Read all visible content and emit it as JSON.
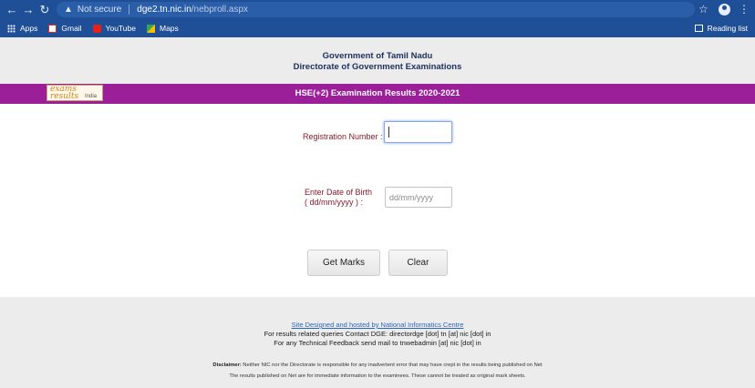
{
  "browser": {
    "not_secure": "Not secure",
    "url_host": "dge2.tn.nic.in",
    "url_path": "/nebproll.aspx",
    "bookmarks": [
      {
        "label": "Apps"
      },
      {
        "label": "Gmail"
      },
      {
        "label": "YouTube"
      },
      {
        "label": "Maps"
      }
    ],
    "reading_list": "Reading list"
  },
  "header": {
    "line1": "Government of Tamil Nadu",
    "line2": "Directorate of Government Examinations"
  },
  "banner": {
    "title": "HSE(+2)  Examination Results 2020-2021",
    "logo_top": "exams",
    "logo_bottom": "results",
    "logo_region": "India"
  },
  "form": {
    "registration_label": "Registration Number :",
    "registration_value": "",
    "dob_label_line1": "Enter Date of Birth",
    "dob_label_line2": "( dd/mm/yyyy ) :",
    "dob_placeholder": "dd/mm/yyyy",
    "get_marks_label": "Get Marks",
    "clear_label": "Clear"
  },
  "footer": {
    "site_link": "Site Designed and hosted by National Informatics Centre",
    "contact_line": "For results related queries Contact DGE:  directordge [dot] tn [at] nic [dot] in",
    "feedback_line": "For any Technical Feedback send mail to tnwebadmin [at] nic [dot] in",
    "disclaimer_label": "Disclaimer:",
    "disclaimer_text": " Neither NIC nor the Directorate is responsible for any inadvertent error that may have crept in the results being published on Net",
    "notice": "The results published on Net are for immediate information to the examinees. These cannot be treated as original mark sheets."
  },
  "colors": {
    "chrome": "#1f4f96",
    "banner": "#9a1f99",
    "label": "#8b1a2e"
  }
}
